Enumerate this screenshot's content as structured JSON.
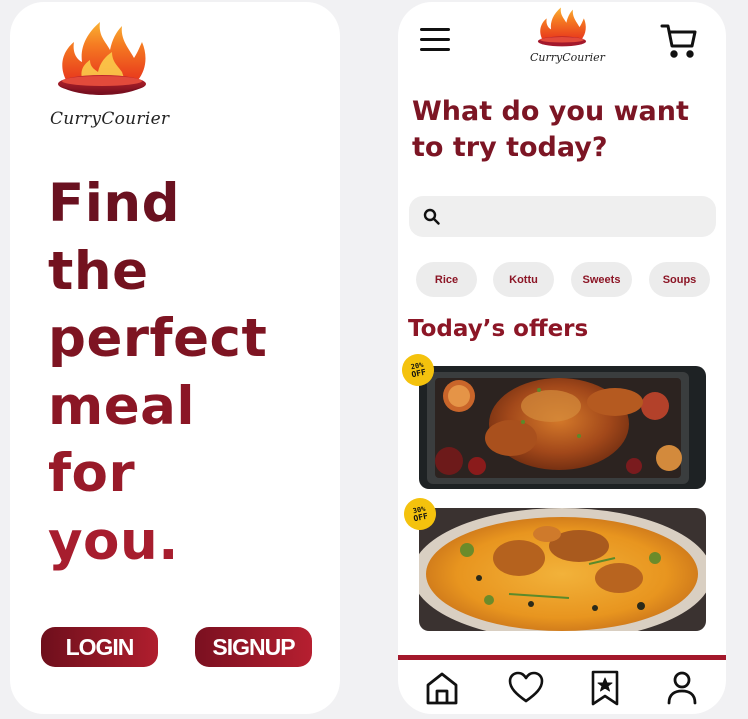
{
  "brand": {
    "name": "CurryCourier"
  },
  "colors": {
    "primary": "#7c1524",
    "accent": "#a3182b",
    "badge": "#f4c20d"
  },
  "welcome": {
    "headline_lines": [
      "Find",
      "the",
      "perfect",
      "meal",
      "for",
      "you."
    ],
    "login_label": "LOGIN",
    "signup_label": "SIGNUP"
  },
  "home": {
    "question": "What do you want to try today?",
    "search": {
      "placeholder": "",
      "value": ""
    },
    "categories": [
      "Rice",
      "Kottu",
      "Sweets",
      "Soups"
    ],
    "offers_title": "Today’s offers",
    "offers": [
      {
        "item": "roast-chicken",
        "badge_percent": "20%",
        "badge_text": "OFF"
      },
      {
        "item": "chicken-biryani",
        "badge_percent": "30%",
        "badge_text": "OFF"
      }
    ],
    "icons": {
      "menu": "menu-icon",
      "cart": "cart-icon",
      "search": "search-icon",
      "nav": [
        "home-icon",
        "heart-icon",
        "bookmark-star-icon",
        "user-icon"
      ]
    }
  }
}
